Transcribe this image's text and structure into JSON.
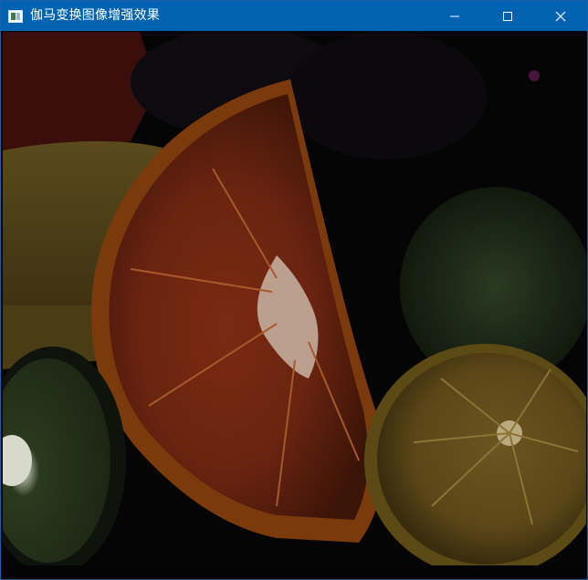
{
  "window": {
    "title": "伽马变换图像增强效果",
    "app_icon": "opencv-window-icon"
  },
  "controls": {
    "minimize_icon": "minimize-icon",
    "maximize_icon": "maximize-icon",
    "close_icon": "close-icon"
  },
  "image": {
    "description_icon": "fruit-photo-gamma-enhanced",
    "accent": "#0063b1"
  }
}
